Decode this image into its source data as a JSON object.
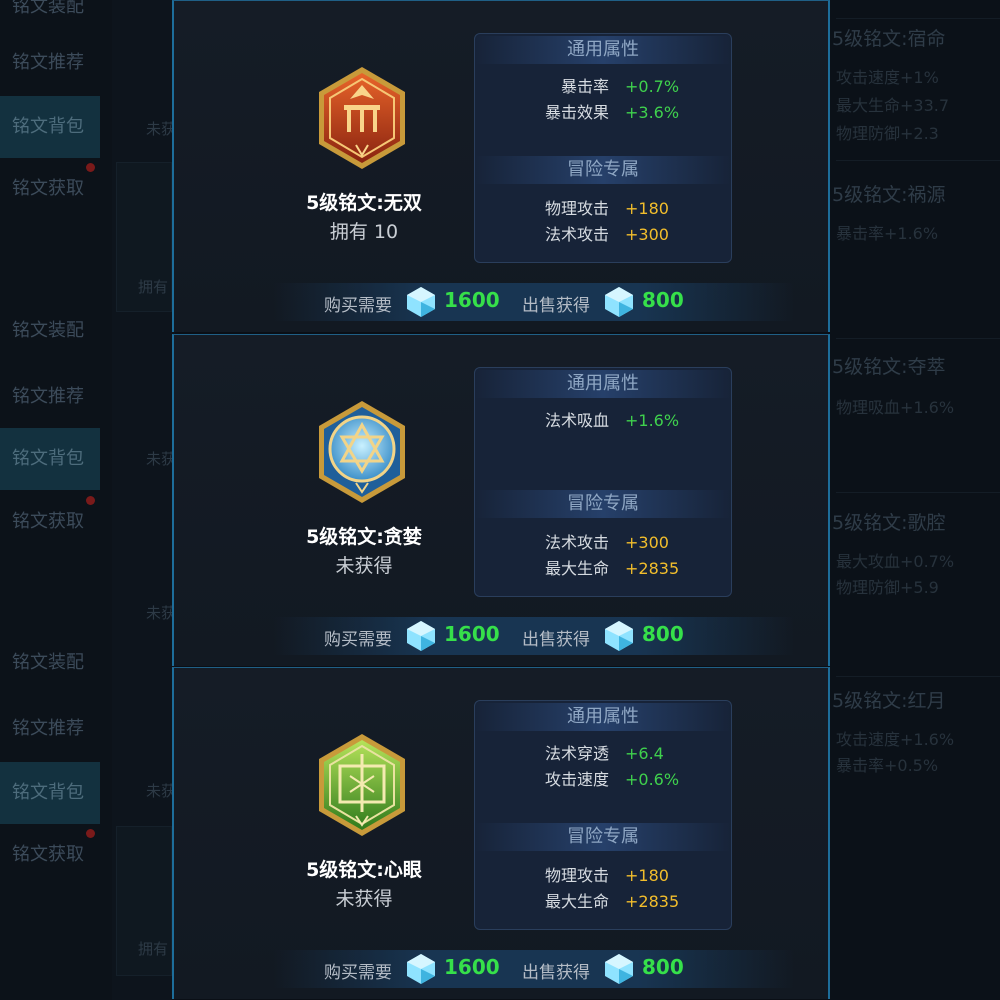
{
  "sidebar": {
    "groups": [
      {
        "items": [
          "铭文推荐",
          "铭文背包",
          "铭文获取"
        ]
      },
      {
        "items": [
          "铭文推荐",
          "铭文背包",
          "铭文获取"
        ]
      },
      {
        "items": [
          "铭文推荐",
          "铭文背包",
          "铭文获取"
        ]
      }
    ],
    "cutoff_label": "铭文装配"
  },
  "background_list": {
    "owned_label": "拥有",
    "not_owned_label": "未获"
  },
  "background_right": [
    {
      "title": "5级铭文:宿命",
      "stats": [
        "攻击速度+1%",
        "最大生命+33.7",
        "物理防御+2.3"
      ]
    },
    {
      "title": "5级铭文:祸源",
      "stats": [
        "暴击率+1.6%"
      ]
    },
    {
      "title": "5级铭文:夺萃",
      "stats": [
        "物理吸血+1.6%"
      ]
    },
    {
      "title": "5级铭文:歌腔",
      "stats": [
        "最大攻血+0.7%",
        "物理防御+5.9"
      ]
    },
    {
      "title": "5级铭文:红月",
      "stats": [
        "攻击速度+1.6%",
        "暴击率+0.5%"
      ]
    }
  ],
  "labels": {
    "general_attrs": "通用属性",
    "adventure_attrs": "冒险专属",
    "buy_label": "购买需要",
    "sell_label": "出售获得"
  },
  "colors": {
    "accent_blue": "#1d6d9a",
    "value_green": "#3fd14d",
    "value_gold": "#f2be2c"
  },
  "runes": [
    {
      "name": "5级铭文:无双",
      "status": "拥有 10",
      "icon": "red-rune-icon",
      "general": [
        {
          "label": "暴击率",
          "value": "+0.7%"
        },
        {
          "label": "暴击效果",
          "value": "+3.6%"
        }
      ],
      "adventure": [
        {
          "label": "物理攻击",
          "value": "+180"
        },
        {
          "label": "法术攻击",
          "value": "+300"
        }
      ],
      "buy_price": "1600",
      "sell_price": "800"
    },
    {
      "name": "5级铭文:贪婪",
      "status": "未获得",
      "icon": "blue-rune-icon",
      "general": [
        {
          "label": "法术吸血",
          "value": "+1.6%"
        }
      ],
      "adventure": [
        {
          "label": "法术攻击",
          "value": "+300"
        },
        {
          "label": "最大生命",
          "value": "+2835"
        }
      ],
      "buy_price": "1600",
      "sell_price": "800"
    },
    {
      "name": "5级铭文:心眼",
      "status": "未获得",
      "icon": "green-rune-icon",
      "general": [
        {
          "label": "法术穿透",
          "value": "+6.4"
        },
        {
          "label": "攻击速度",
          "value": "+0.6%"
        }
      ],
      "adventure": [
        {
          "label": "物理攻击",
          "value": "+180"
        },
        {
          "label": "最大生命",
          "value": "+2835"
        }
      ],
      "buy_price": "1600",
      "sell_price": "800"
    }
  ]
}
